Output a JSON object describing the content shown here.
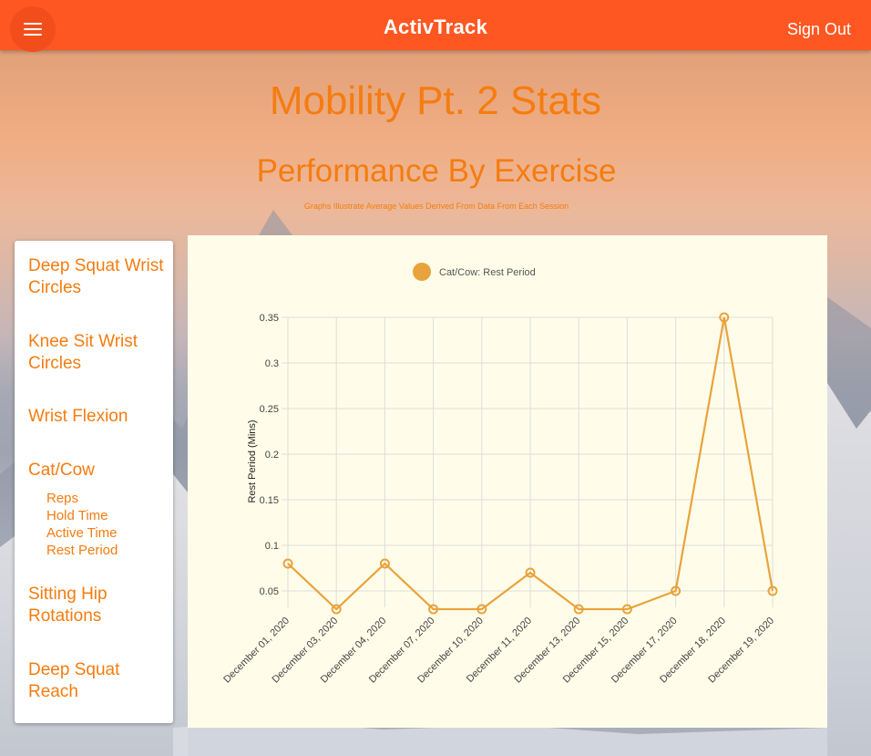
{
  "header": {
    "app_title": "ActivTrack",
    "sign_out_label": "Sign Out",
    "menu_icon": "hamburger-menu-icon",
    "bar_color": "#ff5722"
  },
  "page": {
    "title": "Mobility Pt. 2 Stats",
    "section_title": "Performance By Exercise",
    "section_subtitle": "Graphs Illustrate Average Values Derived From Data From Each Session",
    "accent_color": "#f57c10"
  },
  "sidebar": {
    "exercises": [
      {
        "label": "Deep Squat Wrist Circles"
      },
      {
        "label": "Knee Sit Wrist Circles"
      },
      {
        "label": "Wrist Flexion"
      },
      {
        "label": "Cat/Cow"
      },
      {
        "label": "Sitting Hip Rotations"
      },
      {
        "label": "Deep Squat Reach"
      }
    ],
    "cat_cow_metrics": [
      "Reps",
      "Hold Time",
      "Active Time",
      "Rest Period"
    ]
  },
  "chart_data": {
    "type": "line",
    "title": "",
    "xlabel": "",
    "ylabel": "Rest Period (Mins)",
    "legend_position": "top-center",
    "grid": true,
    "ylim": [
      0.05,
      0.35
    ],
    "yticks": [
      "0.35",
      "0.3",
      "0.25",
      "0.2",
      "0.15",
      "0.1",
      "0.05"
    ],
    "categories": [
      "December 01, 2020",
      "December 03, 2020",
      "December 04, 2020",
      "December 07, 2020",
      "December 10, 2020",
      "December 11, 2020",
      "December 13, 2020",
      "December 15, 2020",
      "December 17, 2020",
      "December 18, 2020",
      "December 19, 2020"
    ],
    "series": [
      {
        "name": "Cat/Cow: Rest Period",
        "color": "#e8a33d",
        "values": [
          0.08,
          0.03,
          0.08,
          0.03,
          0.03,
          0.07,
          0.03,
          0.03,
          0.05,
          0.35,
          0.05
        ]
      }
    ]
  }
}
